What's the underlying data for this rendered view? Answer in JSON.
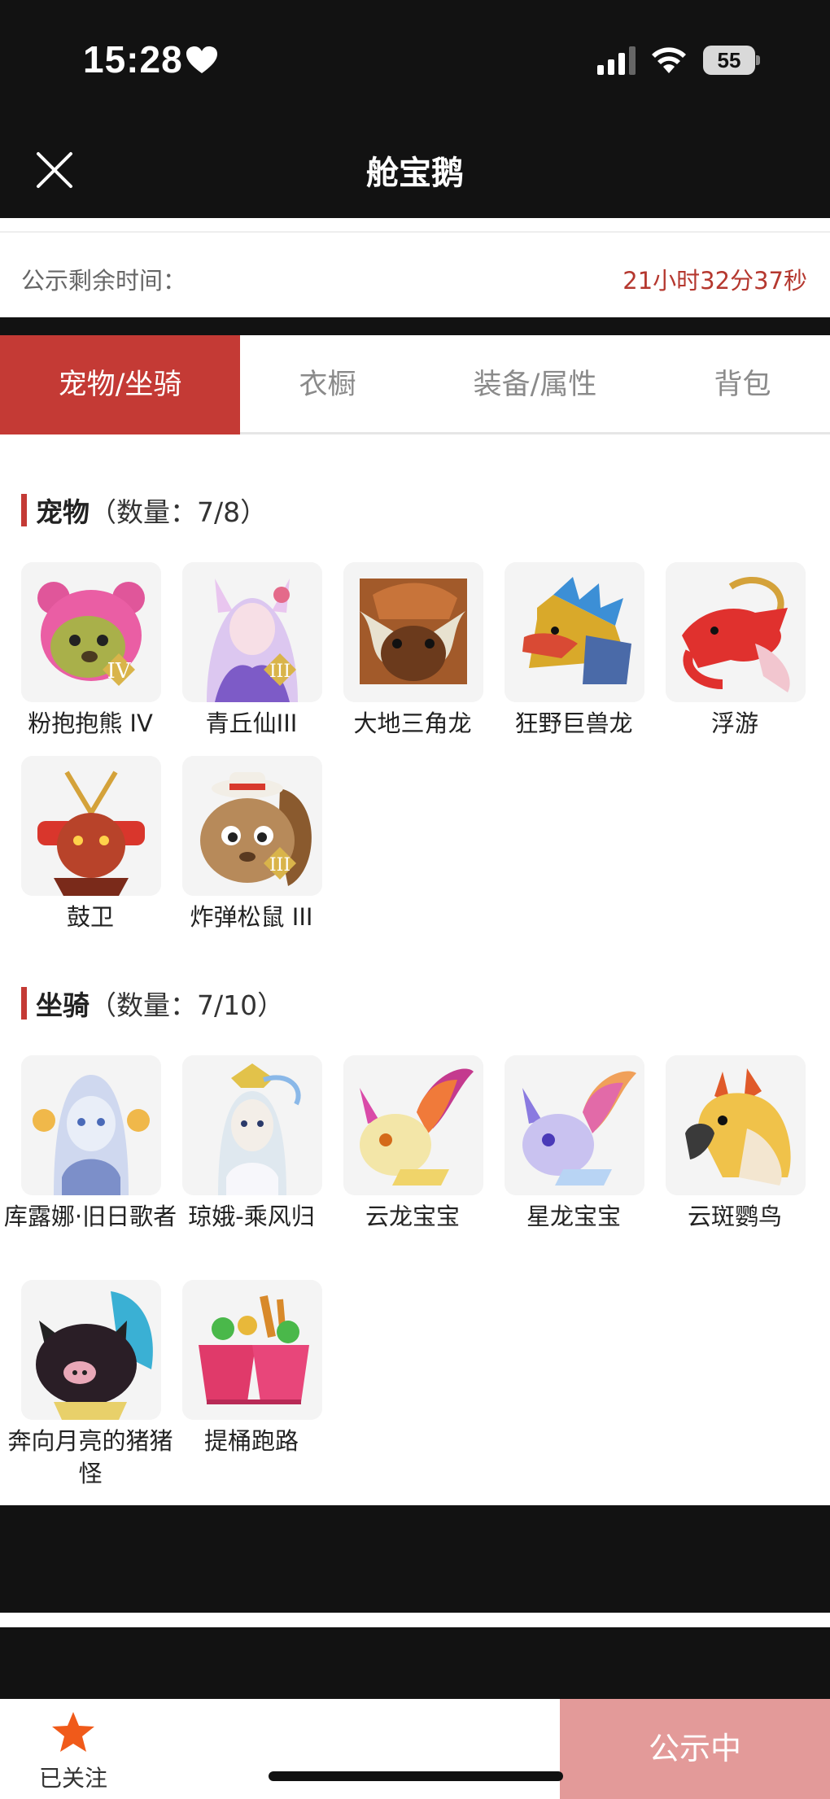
{
  "status": {
    "time": "15:28",
    "battery": "55"
  },
  "header": {
    "title": "舱宝鹅"
  },
  "notice": {
    "label": "公示剩余时间：",
    "remaining": "21小时32分37秒"
  },
  "tabs": [
    {
      "label": "宠物/坐骑",
      "active": true
    },
    {
      "label": "衣橱",
      "active": false
    },
    {
      "label": "装备/属性",
      "active": false
    },
    {
      "label": "背包",
      "active": false
    }
  ],
  "pets": {
    "title": "宠物",
    "count": "（数量：7/8）",
    "items": [
      {
        "name": "粉抱抱熊 IV",
        "badge": "IV"
      },
      {
        "name": "青丘仙III",
        "badge": "III"
      },
      {
        "name": "大地三角龙"
      },
      {
        "name": "狂野巨兽龙"
      },
      {
        "name": "浮游"
      },
      {
        "name": "鼓卫"
      },
      {
        "name": "炸弹松鼠 III",
        "badge": "III"
      }
    ]
  },
  "mounts": {
    "title": "坐骑",
    "count": "（数量：7/10）",
    "items": [
      {
        "name": "库露娜·旧日歌者"
      },
      {
        "name": "琼娥-乘风归"
      },
      {
        "name": "云龙宝宝"
      },
      {
        "name": "星龙宝宝"
      },
      {
        "name": "云斑鹦鸟"
      },
      {
        "name": "奔向月亮的猪猪怪"
      },
      {
        "name": "提桶跑路"
      }
    ]
  },
  "footer": {
    "follow_label": "已关注",
    "status_button": "公示中"
  },
  "colors": {
    "accent": "#c43a35",
    "timer": "#b5382f",
    "button": "#e39a99",
    "star": "#f05a1a"
  },
  "icons": [
    "heart-icon",
    "signal-icon",
    "wifi-icon",
    "battery-icon",
    "close-icon",
    "star-icon"
  ]
}
